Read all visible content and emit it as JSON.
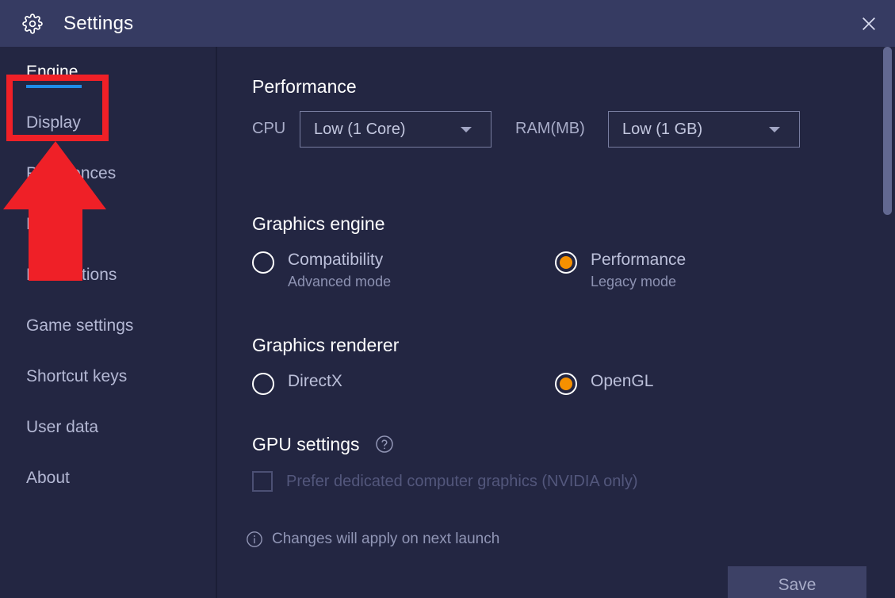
{
  "window": {
    "title": "Settings",
    "gear_icon": "gear-icon",
    "close_icon": "close-icon"
  },
  "sidebar": {
    "items": [
      {
        "label": "Engine",
        "active": true
      },
      {
        "label": "Display",
        "active": false
      },
      {
        "label": "Preferences",
        "active": false
      },
      {
        "label": "Device",
        "active": false
      },
      {
        "label": "Notifications",
        "active": false
      },
      {
        "label": "Game settings",
        "active": false
      },
      {
        "label": "Shortcut keys",
        "active": false
      },
      {
        "label": "User data",
        "active": false
      },
      {
        "label": "About",
        "active": false
      }
    ]
  },
  "main": {
    "performance": {
      "title": "Performance",
      "cpu_label": "CPU",
      "cpu_value": "Low (1 Core)",
      "ram_label": "RAM(MB)",
      "ram_value": "Low (1 GB)"
    },
    "graphics_engine": {
      "title": "Graphics engine",
      "options": [
        {
          "label": "Compatibility",
          "sub": "Advanced mode",
          "checked": false
        },
        {
          "label": "Performance",
          "sub": "Legacy mode",
          "checked": true
        }
      ]
    },
    "graphics_renderer": {
      "title": "Graphics renderer",
      "options": [
        {
          "label": "DirectX",
          "checked": false
        },
        {
          "label": "OpenGL",
          "checked": true
        }
      ]
    },
    "gpu_settings": {
      "title": "GPU settings",
      "help_icon": "help-circle-icon",
      "checkbox_label": "Prefer dedicated computer graphics (NVIDIA only)",
      "checkbox_checked": false
    },
    "footer": {
      "info_icon": "info-circle-icon",
      "note": "Changes will apply on next launch",
      "save_label": "Save"
    }
  },
  "colors": {
    "titlebar": "#363b62",
    "background": "#232642",
    "accent_orange": "#f59000",
    "accent_blue": "#1e8ce8",
    "annotation_red": "#ef2027",
    "scrollbar": "#626891"
  },
  "annotation": {
    "highlight_target": "Engine",
    "arrow_direction": "up"
  }
}
